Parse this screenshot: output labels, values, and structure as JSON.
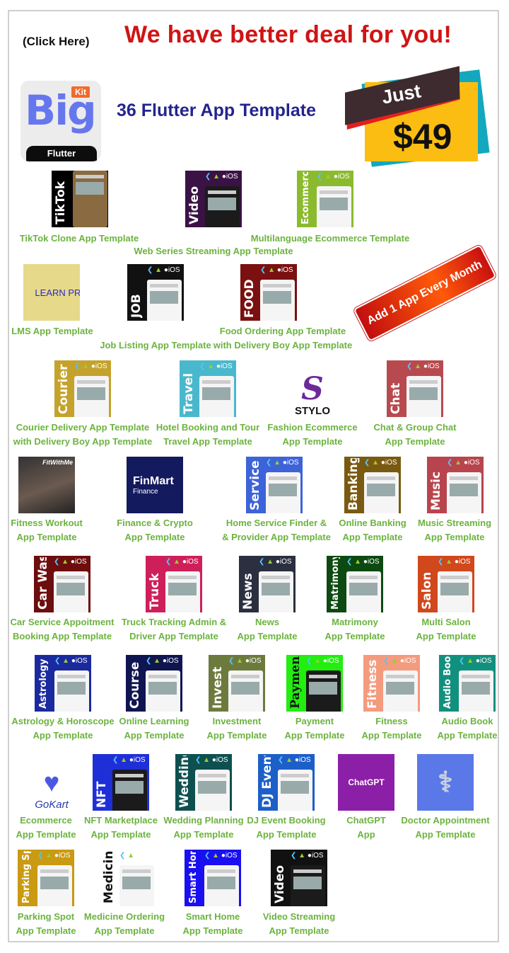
{
  "header": {
    "click_here": "(Click Here)",
    "headline": "We have better deal for you!",
    "subtitle": "36 Flutter App Template"
  },
  "logo": {
    "big": "Big",
    "kit": "Kit",
    "flutter": "Flutter"
  },
  "price": {
    "just": "Just",
    "amount": "$49"
  },
  "ribbon": "Add 1 App Every Month",
  "platform_icons": "flutter-icon android-icon apple-icon iOS",
  "apps": [
    {
      "key": "tiktok",
      "thumb_label": "TikTok",
      "bg": "#000000",
      "caption": [
        "TikTok Clone App Template"
      ]
    },
    {
      "key": "video-series",
      "thumb_label": "Video",
      "bg": "#3a1245",
      "caption": [
        "Web Series Streaming App Template"
      ]
    },
    {
      "key": "ecommerce-multi",
      "thumb_label": "Ecommerce",
      "bg": "#8cba2e",
      "caption": [
        "Multilanguage Ecommerce Template"
      ]
    },
    {
      "key": "lms",
      "thumb_label": "LEARN PRO",
      "bg": "#e6d98a",
      "caption": [
        "LMS App Template"
      ]
    },
    {
      "key": "job",
      "thumb_label": "JOB",
      "bg": "#111111",
      "caption": [
        "Job Listing App Template"
      ]
    },
    {
      "key": "food",
      "thumb_label": "FOOD",
      "bg": "#7a1010",
      "caption": [
        "Food Ordering App Template",
        "with Delivery Boy App Template"
      ]
    },
    {
      "key": "courier",
      "thumb_label": "Courier",
      "bg": "#c4a22c",
      "caption": [
        "Courier Delivery App Template",
        "with Delivery Boy App Template"
      ]
    },
    {
      "key": "travel",
      "thumb_label": "Travel",
      "bg": "#49b8cc",
      "caption": [
        "Hotel Booking and Tour",
        "Travel App Template"
      ]
    },
    {
      "key": "stylo",
      "thumb_label": "STYLO",
      "bg": "#ffffff",
      "caption": [
        "Fashion Ecommerce",
        "App Template"
      ]
    },
    {
      "key": "chat",
      "thumb_label": "Chat",
      "bg": "#b84a4f",
      "caption": [
        "Chat & Group Chat",
        "App Template"
      ]
    },
    {
      "key": "fitness-workout",
      "thumb_label": "FitWithMe",
      "bg": "#2a2a2a",
      "caption": [
        "Fitness Workout",
        "App Template"
      ]
    },
    {
      "key": "finmart",
      "thumb_label": "FinMart",
      "thumb_sub": "Finance",
      "bg": "#141a5e",
      "caption": [
        "Finance & Crypto",
        "App Template"
      ]
    },
    {
      "key": "service",
      "thumb_label": "Service",
      "bg": "#3d63d8",
      "caption": [
        "Home Service Finder &",
        "& Provider App Template"
      ]
    },
    {
      "key": "banking",
      "thumb_label": "Banking",
      "bg": "#7a5a10",
      "caption": [
        "Online Banking",
        "App Template"
      ]
    },
    {
      "key": "music",
      "thumb_label": "Music",
      "bg": "#b8454e",
      "caption": [
        "Music Streaming",
        "App Template"
      ]
    },
    {
      "key": "car-wash",
      "thumb_label": "Car Wash",
      "bg": "#6e0d0d",
      "caption": [
        "Car Service Appoitment",
        "Booking App Template"
      ]
    },
    {
      "key": "truck",
      "thumb_label": "Truck",
      "bg": "#cf1f5a",
      "caption": [
        "Truck Tracking Admin &",
        "Driver App Template"
      ]
    },
    {
      "key": "news",
      "thumb_label": "News",
      "bg": "#2b3040",
      "caption": [
        "News",
        "App Template"
      ]
    },
    {
      "key": "matrimony",
      "thumb_label": "Matrimony",
      "bg": "#0d4a12",
      "caption": [
        "Matrimony",
        "App Template"
      ]
    },
    {
      "key": "salon",
      "thumb_label": "Salon",
      "bg": "#d0481c",
      "caption": [
        "Multi Salon",
        "App Template"
      ]
    },
    {
      "key": "astrology",
      "thumb_label": "Astrology",
      "bg": "#1a2a9e",
      "caption": [
        "Astrology & Horoscope",
        "App Template"
      ]
    },
    {
      "key": "course",
      "thumb_label": "Course",
      "bg": "#0f1550",
      "caption": [
        "Online Learning",
        "App Template"
      ]
    },
    {
      "key": "invest",
      "thumb_label": "Invest",
      "bg": "#6d7a3e",
      "caption": [
        "Investment",
        "App Template"
      ]
    },
    {
      "key": "payment",
      "thumb_label": "Payment",
      "bg": "#22ee10",
      "caption": [
        "Payment",
        "App Template"
      ]
    },
    {
      "key": "fitness",
      "thumb_label": "Fitness",
      "bg": "#f49b7e",
      "caption": [
        "Fitness",
        "App Template"
      ]
    },
    {
      "key": "audio-book",
      "thumb_label": "Audio Book",
      "bg": "#12907e",
      "caption": [
        "Audio Book",
        "App Template"
      ]
    },
    {
      "key": "gokart",
      "thumb_label": "GoKart",
      "bg": "#ffffff",
      "caption": [
        "Ecommerce",
        "App Template"
      ]
    },
    {
      "key": "nft",
      "thumb_label": "NFT",
      "bg": "#1f2fd8",
      "caption": [
        "NFT Marketplace",
        "App Template"
      ]
    },
    {
      "key": "wedding",
      "thumb_label": "Wedding",
      "bg": "#0e5050",
      "caption": [
        "Wedding Planning",
        "App Template"
      ]
    },
    {
      "key": "dj-event",
      "thumb_label": "DJ Event",
      "bg": "#1d5fc8",
      "caption": [
        "DJ Event Booking",
        "App Template"
      ]
    },
    {
      "key": "chatgpt",
      "thumb_label": "ChatGPT",
      "bg": "#8c1fa8",
      "caption": [
        "ChatGPT",
        "App"
      ]
    },
    {
      "key": "doctor",
      "thumb_label": "stethoscope",
      "bg": "#5a78e8",
      "caption": [
        "Doctor Appointment",
        "App Template"
      ]
    },
    {
      "key": "parking",
      "thumb_label": "Parking Spot",
      "bg": "#c99a12",
      "caption": [
        "Parking Spot",
        "App Template"
      ]
    },
    {
      "key": "medicine",
      "thumb_label": "Medicine",
      "bg": "#ffffff",
      "caption": [
        "Medicine Ordering",
        "App Template"
      ]
    },
    {
      "key": "smart-home",
      "thumb_label": "Smart Home",
      "bg": "#1a0ff0",
      "caption": [
        "Smart Home",
        "App Template"
      ]
    },
    {
      "key": "video-streaming",
      "thumb_label": "Video",
      "bg": "#111111",
      "caption": [
        "Video Streaming",
        "App Template"
      ]
    }
  ]
}
